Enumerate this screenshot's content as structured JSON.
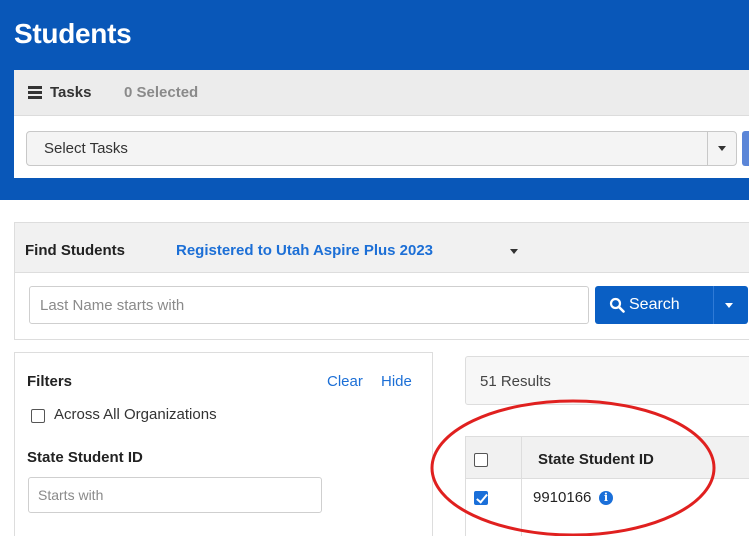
{
  "page": {
    "title": "Students"
  },
  "tasks": {
    "label": "Tasks",
    "selected_count": "0 Selected",
    "select_value": "Select Tasks"
  },
  "find": {
    "label": "Find Students",
    "filter_value": "Registered to Utah Aspire Plus 2023",
    "search_placeholder": "Last Name starts with",
    "search_button": "Search"
  },
  "filters": {
    "title": "Filters",
    "clear": "Clear",
    "hide": "Hide",
    "across_label": "Across All Organizations",
    "ssid_title": "State Student ID",
    "ssid_placeholder": "Starts with"
  },
  "results": {
    "count": "51 Results",
    "columns": [
      "State Student ID"
    ],
    "rows": [
      {
        "state_student_id": "9910166",
        "selected": true
      }
    ]
  },
  "colors": {
    "header": "#0957b8",
    "primary_button": "#0a5fc4",
    "link": "#1c6fd6",
    "annotation_circle": "#e0201f"
  },
  "icons": [
    "tasks-menu-icon",
    "search-icon",
    "info-icon",
    "chevron-down-icon",
    "checkbox-checked-icon"
  ]
}
